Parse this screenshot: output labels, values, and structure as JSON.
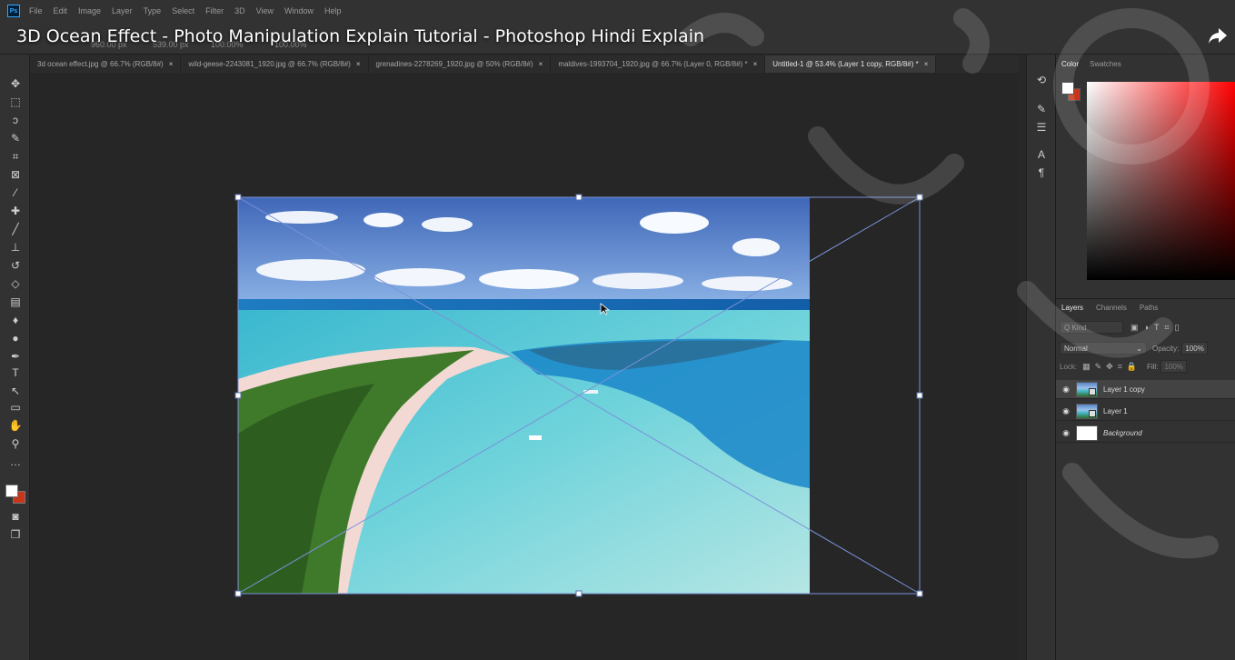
{
  "video_title": "3D Ocean Effect - Photo Manipulation Explain Tutorial - Photoshop Hindi Explain",
  "app": {
    "logo": "Ps"
  },
  "menu": [
    "File",
    "Edit",
    "Image",
    "Layer",
    "Type",
    "Select",
    "Filter",
    "3D",
    "View",
    "Window",
    "Help"
  ],
  "options_bar": {
    "width": "960.00 px",
    "height": "539.00 px",
    "w_pct": "100.00%",
    "h_pct": "100.00%"
  },
  "doc_tabs": [
    {
      "label": "3d ocean effect.jpg @ 66.7% (RGB/8#)",
      "close": "×"
    },
    {
      "label": "wild-geese-2243081_1920.jpg @ 66.7% (RGB/8#)",
      "close": "×"
    },
    {
      "label": "grenadines-2278269_1920.jpg @ 50% (RGB/8#)",
      "close": "×"
    },
    {
      "label": "maldives-1993704_1920.jpg @ 66.7% (Layer 0, RGB/8#) *",
      "close": "×"
    },
    {
      "label": "Untitled-1 @ 53.4% (Layer 1 copy, RGB/8#) *",
      "close": "×"
    }
  ],
  "color_panel": {
    "tabs": [
      "Color",
      "Swatches"
    ],
    "foreground": "#ffffff",
    "background": "#c8361b"
  },
  "layers_panel": {
    "tabs": [
      "Layers",
      "Channels",
      "Paths"
    ],
    "filter_placeholder": "Q Kind",
    "blend_mode": "Normal",
    "opacity_label": "Opacity:",
    "opacity_value": "100%",
    "lock_label": "Lock:",
    "fill_label": "Fill:",
    "fill_value": "100%",
    "layers": [
      {
        "name": "Layer 1 copy",
        "selected": true
      },
      {
        "name": "Layer 1",
        "selected": false
      },
      {
        "name": "Background",
        "selected": false
      }
    ]
  }
}
